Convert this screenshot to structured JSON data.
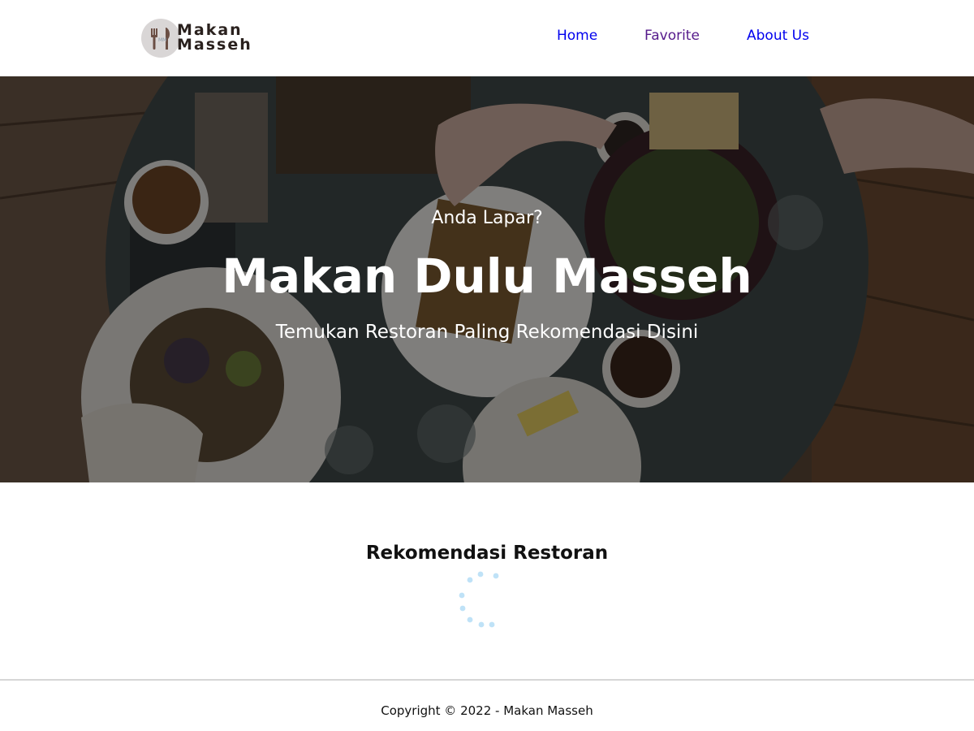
{
  "brand": {
    "logo_line1": "Makan",
    "logo_line2": "Masseh",
    "logo_monogram": "MM"
  },
  "nav": {
    "items": [
      {
        "label": "Home",
        "state": "unvisited"
      },
      {
        "label": "Favorite",
        "state": "visited"
      },
      {
        "label": "About Us",
        "state": "unvisited"
      }
    ]
  },
  "hero": {
    "tagline": "Anda Lapar?",
    "title": "Makan Dulu Masseh",
    "subtitle": "Temukan Restoran Paling Rekomendasi Disini"
  },
  "main": {
    "section_title": "Rekomendasi Restoran",
    "loading_icon": "spinner-icon"
  },
  "footer": {
    "copyright": "Copyright © 2022 - Makan Masseh"
  },
  "colors": {
    "link": "#0000ee",
    "link_visited": "#551a8b",
    "spinner": "#bfe2f7",
    "hero_text": "#ffffff"
  }
}
